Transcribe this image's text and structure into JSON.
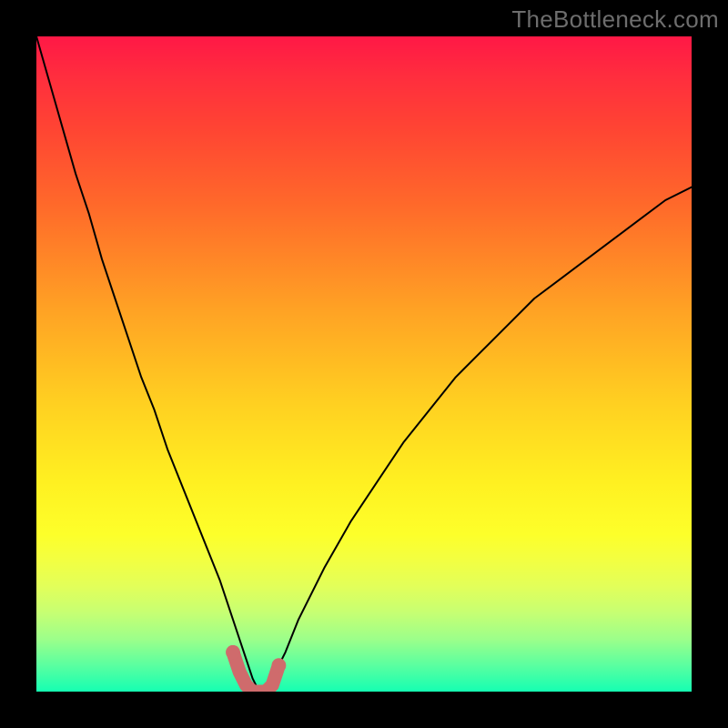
{
  "watermark": {
    "text": "TheBottleneck.com"
  },
  "chart_data": {
    "type": "line",
    "title": "",
    "xlabel": "",
    "ylabel": "",
    "legend": false,
    "grid": false,
    "xlim": [
      0,
      100
    ],
    "ylim": [
      0,
      100
    ],
    "series": [
      {
        "name": "bottleneck-curve",
        "color": "#000000",
        "x": [
          0,
          2,
          4,
          6,
          8,
          10,
          12,
          14,
          16,
          18,
          20,
          22,
          24,
          26,
          28,
          30,
          31,
          32,
          33,
          34,
          35,
          36,
          38,
          40,
          44,
          48,
          52,
          56,
          60,
          64,
          68,
          72,
          76,
          80,
          84,
          88,
          92,
          96,
          100
        ],
        "y": [
          100,
          93,
          86,
          79,
          73,
          66,
          60,
          54,
          48,
          43,
          37,
          32,
          27,
          22,
          17,
          11,
          8,
          5,
          2,
          0,
          0,
          2,
          6,
          11,
          19,
          26,
          32,
          38,
          43,
          48,
          52,
          56,
          60,
          63,
          66,
          69,
          72,
          75,
          77
        ]
      },
      {
        "name": "highlight-min",
        "color": "#cf6b6c",
        "x": [
          30,
          31,
          32,
          33,
          34,
          35,
          36,
          37
        ],
        "y": [
          6,
          3,
          1,
          0,
          0,
          0,
          1,
          4
        ]
      }
    ],
    "annotations": [
      {
        "text": "TheBottleneck.com",
        "position": "top-right"
      }
    ]
  }
}
